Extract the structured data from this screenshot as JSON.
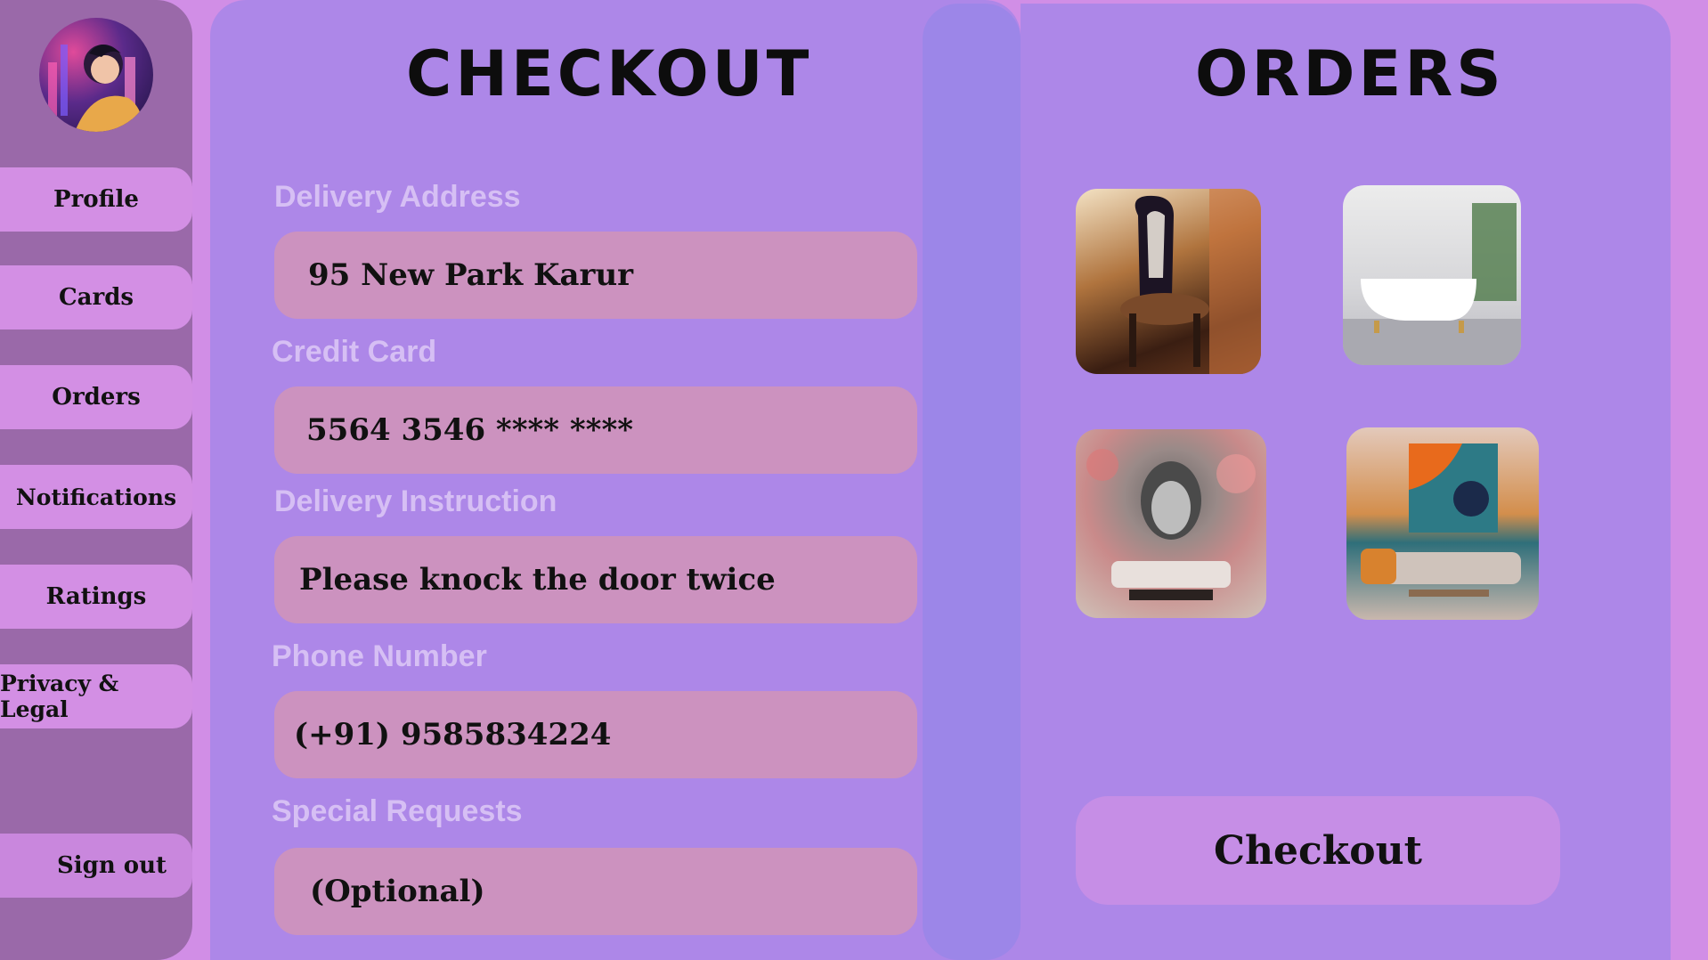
{
  "sidebar": {
    "avatar_icon": "avatar-illustration",
    "items": [
      {
        "label": "Profile"
      },
      {
        "label": "Cards"
      },
      {
        "label": "Orders"
      },
      {
        "label": "Notifications"
      },
      {
        "label": "Ratings"
      },
      {
        "label": "Privacy & Legal"
      }
    ],
    "signout_label": "Sign out"
  },
  "checkout": {
    "title": "CHECKOUT",
    "fields": [
      {
        "label": "Delivery Address",
        "value": "95 New Park Karur"
      },
      {
        "label": "Credit Card",
        "value": "5564 3546 **** ****"
      },
      {
        "label": "Delivery Instruction",
        "value": "Please knock the door twice"
      },
      {
        "label": "Phone Number",
        "value": "(+91) 9585834224"
      },
      {
        "label": "Special Requests",
        "value": "(Optional)"
      }
    ]
  },
  "orders": {
    "title": "ORDERS",
    "items": [
      {
        "icon": "chair-image"
      },
      {
        "icon": "bathtub-image"
      },
      {
        "icon": "wall-art-image"
      },
      {
        "icon": "living-room-image"
      }
    ],
    "checkout_label": "Checkout"
  },
  "colors": {
    "background": "#d18ee6",
    "sidebar": "#9a69a9",
    "panel": "#ad87e8",
    "field": "#cc92bf",
    "label": "#d6bff4"
  }
}
